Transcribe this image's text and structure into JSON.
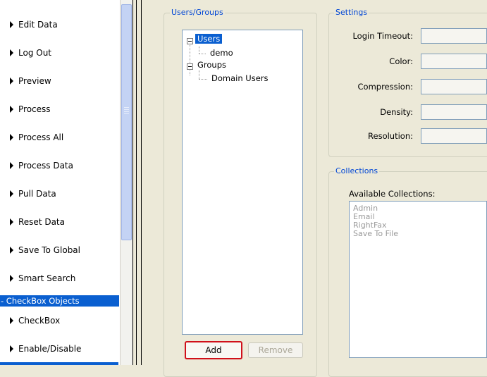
{
  "sidebar": {
    "items": [
      {
        "label": "Edit Data"
      },
      {
        "label": "Log Out"
      },
      {
        "label": "Preview"
      },
      {
        "label": "Process"
      },
      {
        "label": "Process All"
      },
      {
        "label": "Process Data"
      },
      {
        "label": "Pull Data"
      },
      {
        "label": "Reset Data"
      },
      {
        "label": "Save To Global"
      },
      {
        "label": "Smart Search"
      }
    ],
    "section_header": "- CheckBox Objects",
    "section_items": [
      {
        "label": "CheckBox"
      },
      {
        "label": "Enable/Disable"
      }
    ]
  },
  "users_groups": {
    "title": "Users/Groups",
    "tree": {
      "users_node": "Users",
      "users_child": "demo",
      "groups_node": "Groups",
      "groups_child": "Domain Users"
    },
    "add_label": "Add",
    "remove_label": "Remove"
  },
  "settings": {
    "title": "Settings",
    "fields": [
      {
        "label": "Login Timeout:",
        "value": ""
      },
      {
        "label": "Color:",
        "value": ""
      },
      {
        "label": "Compression:",
        "value": ""
      },
      {
        "label": "Density:",
        "value": ""
      },
      {
        "label": "Resolution:",
        "value": ""
      }
    ]
  },
  "collections": {
    "title": "Collections",
    "available_label": "Available Collections:",
    "items": [
      "Admin",
      "Email",
      "RightFax",
      "Save To File"
    ]
  },
  "colors": {
    "selection": "#0a5fd0",
    "group_title": "#0046d5",
    "highlight_border": "#d0101a"
  }
}
